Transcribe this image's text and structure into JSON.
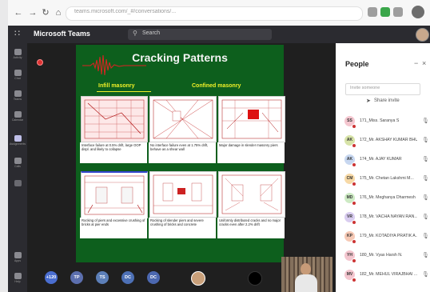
{
  "browser": {
    "url": "teams.microsoft.com/_#/conversations/...",
    "controls": [
      "back",
      "refresh",
      "home"
    ]
  },
  "teams": {
    "app_name": "Microsoft Teams",
    "search_placeholder": "Search",
    "rail_items": [
      "Activity",
      "Chat",
      "Teams",
      "Calendar",
      "Assignments",
      "Calls",
      "",
      "More",
      "Apps",
      "Help"
    ]
  },
  "slide": {
    "title": "Cracking Patterns",
    "sub_infill": "Infill masonry",
    "sub_confined": "Confined masonry",
    "captions": [
      "Interface failure at 0.5% drift, large OOP displ. and likely to collapse",
      "No interface failure even at 1.75% drift, behave as a shear wall",
      "Major damage in slender masonry piers",
      "Rocking of piers and excessive crushing of bricks at pier ends",
      "Rocking of slender piers and severe crushing of bricks and concrete",
      "Uniformly distributed cracks and no major cracks even after 2.2% drift"
    ]
  },
  "people": {
    "title": "People",
    "invite_placeholder": "Invite someone",
    "share_invite": "Share invite",
    "participants": [
      {
        "initials": "SS",
        "name": "171_Miss. Saranya S",
        "color": "#f4c6cf"
      },
      {
        "initials": "AK",
        "name": "172_Mr. AKSHAY KUMAR BHUD...",
        "color": "#d7e3a8"
      },
      {
        "initials": "AK",
        "name": "174_Mr. AJAY KUMAR",
        "color": "#c7d7f0"
      },
      {
        "initials": "CM",
        "name": "175_Mr. Chetan Lakshmi M...",
        "color": "#f7d9a6"
      },
      {
        "initials": "MD",
        "name": "176_Mr. Meghanya Dharmesh",
        "color": "#cdeac4"
      },
      {
        "initials": "VR",
        "name": "178_Mr. VACHA NAYAN RAN...",
        "color": "#d9cdf0"
      },
      {
        "initials": "KP",
        "name": "179_Mr. KOTADIYA PRATIK A...",
        "color": "#f6c9b5"
      },
      {
        "initials": "YH",
        "name": "180_Mr. Vyas Harsh N.",
        "color": "#f4c6cf"
      },
      {
        "initials": "MV",
        "name": "182_Mr. MEHUL VIRAJBHAI ...",
        "color": "#f4c6cf"
      }
    ]
  },
  "gallery": {
    "tiles": [
      {
        "label": "+120",
        "color": "#4a6ed0"
      },
      {
        "label": "TP",
        "color": "#5c6fae"
      },
      {
        "label": "TS",
        "color": "#5c7fb8"
      },
      {
        "label": "DC",
        "color": "#4d70b5"
      },
      {
        "label": "DC",
        "color": "#4c68b0"
      }
    ]
  }
}
